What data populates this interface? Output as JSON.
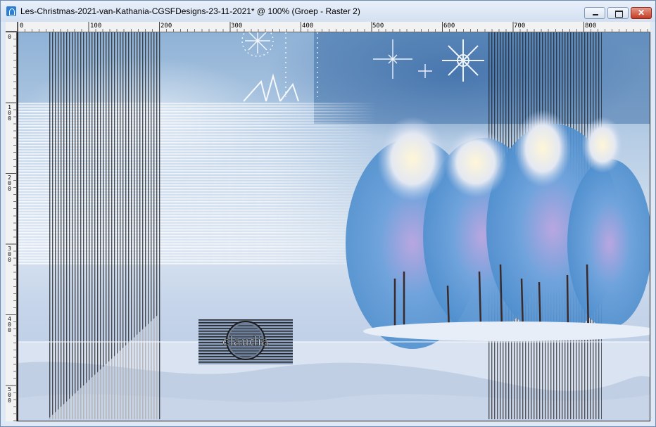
{
  "window": {
    "title": "Les-Christmas-2021-van-Kathania-CGSFDesigns-23-11-2021* @ 100% (Groep - Raster 2)",
    "buttons": {
      "minimize": "minimize",
      "maximize": "maximize",
      "close": "✕"
    }
  },
  "ruler": {
    "horizontal": [
      "0",
      "100",
      "200",
      "300",
      "400",
      "500",
      "600",
      "700",
      "800"
    ],
    "vertical": [
      "0",
      "100",
      "200",
      "300",
      "400",
      "500"
    ]
  },
  "canvas": {
    "watermark_text": "claudia",
    "colors": {
      "sky": "#8fb2d6",
      "snow": "#dfe8f4",
      "trees": "#7aa6d8",
      "lines": "#1a1a1a"
    }
  }
}
